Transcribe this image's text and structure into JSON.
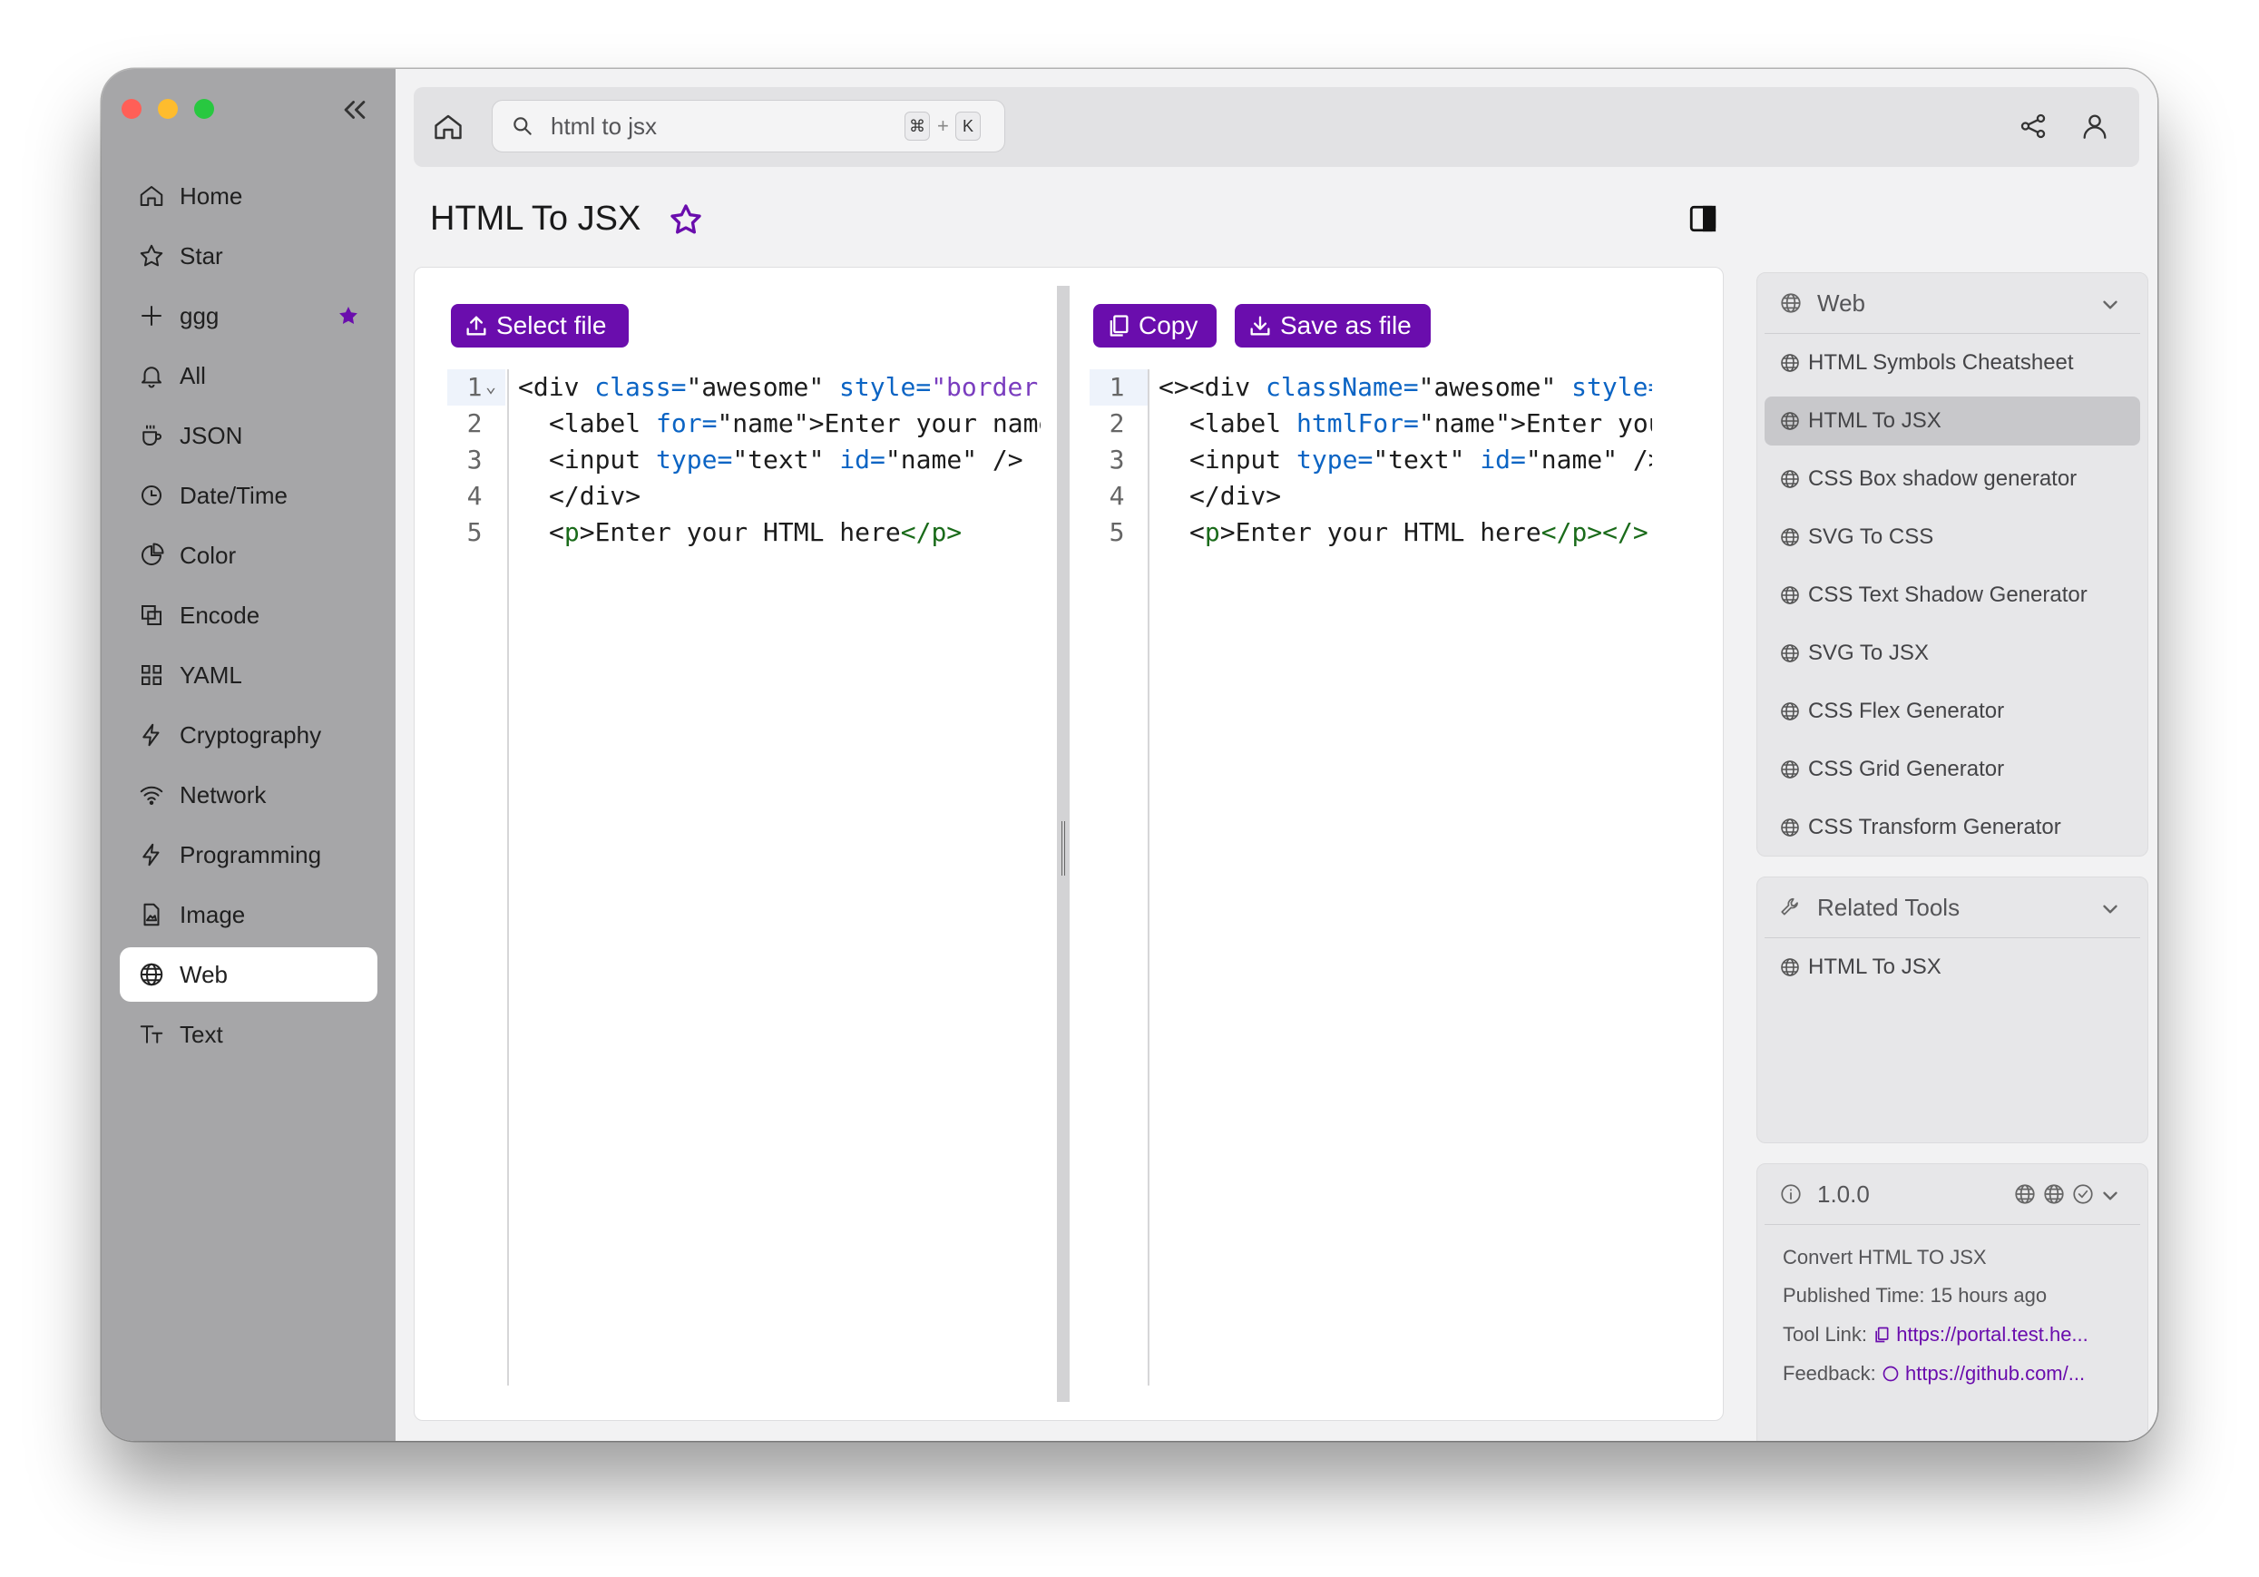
{
  "sidebar": {
    "items": [
      {
        "label": "Home",
        "icon": "home-icon"
      },
      {
        "label": "Star",
        "icon": "star-icon"
      },
      {
        "label": "ggg",
        "icon": "plus-icon",
        "starred": true
      },
      {
        "label": "All",
        "icon": "bell-icon"
      },
      {
        "label": "JSON",
        "icon": "cup-icon"
      },
      {
        "label": "Date/Time",
        "icon": "clock-icon"
      },
      {
        "label": "Color",
        "icon": "pie-icon"
      },
      {
        "label": "Encode",
        "icon": "encode-icon"
      },
      {
        "label": "YAML",
        "icon": "grid-icon"
      },
      {
        "label": "Cryptography",
        "icon": "bolt-icon"
      },
      {
        "label": "Network",
        "icon": "wifi-icon"
      },
      {
        "label": "Programming",
        "icon": "bolt-icon"
      },
      {
        "label": "Image",
        "icon": "image-icon"
      },
      {
        "label": "Web",
        "icon": "globe-icon",
        "active": true
      },
      {
        "label": "Text",
        "icon": "text-icon"
      }
    ]
  },
  "topbar": {
    "search_value": "html to jsx",
    "shortcut_cmd": "⌘",
    "shortcut_plus": "+",
    "shortcut_key": "K"
  },
  "page": {
    "title": "HTML To JSX"
  },
  "editor": {
    "select_label": "Select file",
    "copy_label": "Copy",
    "save_label": "Save as file",
    "left_line_numbers": [
      "1",
      "2",
      "3",
      "4",
      "5"
    ],
    "right_line_numbers": [
      "1",
      "2",
      "3",
      "4",
      "5"
    ]
  },
  "web_panel": {
    "header": "Web",
    "items": [
      "HTML Symbols Cheatsheet",
      "HTML To JSX",
      "CSS Box shadow generator",
      "SVG To CSS",
      "CSS Text Shadow Generator",
      "SVG To JSX",
      "CSS Flex Generator",
      "CSS Grid Generator",
      "CSS Transform Generator"
    ],
    "active_index": 1
  },
  "related_panel": {
    "header": "Related Tools",
    "items": [
      "HTML To JSX"
    ]
  },
  "info_panel": {
    "version": "1.0.0",
    "description": "Convert HTML TO JSX",
    "published_label": "Published Time:",
    "published_value": "15 hours ago",
    "tool_link_label": "Tool Link:",
    "tool_link_value": "https://portal.test.he...",
    "feedback_label": "Feedback:",
    "feedback_value": "https://github.com/..."
  },
  "colors": {
    "accent": "#6a0dad",
    "sidebar_bg": "#a6a6a8",
    "active_item_bg": "#ffffff"
  }
}
